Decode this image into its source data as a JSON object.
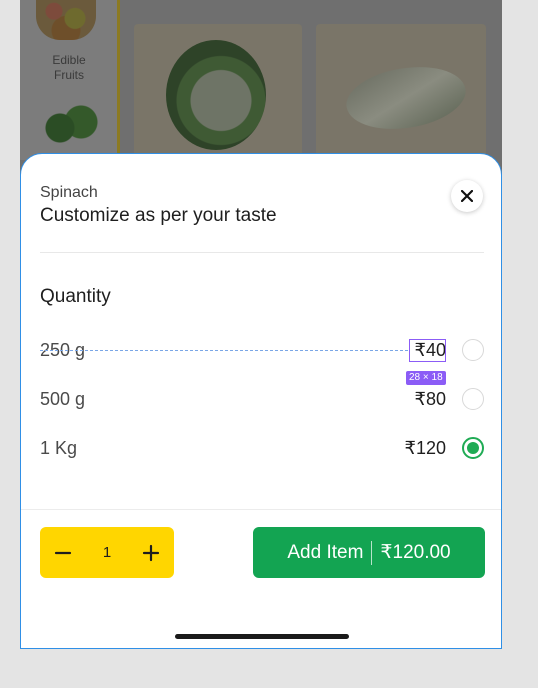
{
  "background": {
    "category_label": "Edible Fruits"
  },
  "sheet": {
    "product_name": "Spinach",
    "title": "Customize as per your taste",
    "section_label": "Quantity",
    "options": [
      {
        "name": "250 g",
        "price": "₹40",
        "selected": false
      },
      {
        "name": "500 g",
        "price": "₹80",
        "selected": false
      },
      {
        "name": "1 Kg",
        "price": "₹120",
        "selected": true
      }
    ],
    "measure_badge": "28 × 18",
    "quantity": "1",
    "add_button": {
      "label": "Add Item",
      "price": "₹120.00"
    }
  },
  "colors": {
    "accent_green": "#13a452",
    "stepper_yellow": "#ffd600",
    "selection_border": "#2f8fe6",
    "inspect_purple": "#8b5cf6"
  },
  "icons": {
    "close": "close-icon",
    "minus": "minus-icon",
    "plus": "plus-icon"
  }
}
